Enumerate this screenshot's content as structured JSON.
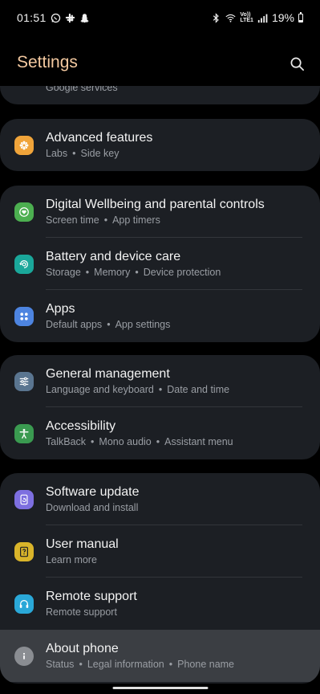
{
  "status_bar": {
    "time": "01:51",
    "left_icons": [
      "whatsapp-icon",
      "slack-icon",
      "snapchat-icon"
    ],
    "right_icons": [
      "bluetooth-icon",
      "wifi-icon",
      "volte-icon",
      "signal-icon"
    ],
    "volte_text_top": "Vo))",
    "volte_text_bottom": "LTE1",
    "battery": "19%"
  },
  "header": {
    "title": "Settings",
    "search_icon": "search-icon"
  },
  "partial_item": {
    "subtitle": "Google services"
  },
  "groups": [
    {
      "items": [
        {
          "icon": "gear-flower-icon",
          "icon_color": "#f0a43a",
          "title": "Advanced features",
          "subtitle": [
            "Labs",
            "Side key"
          ]
        }
      ]
    },
    {
      "items": [
        {
          "icon": "heart-circle-icon",
          "icon_color": "#4caf50",
          "title": "Digital Wellbeing and parental controls",
          "subtitle": [
            "Screen time",
            "App timers"
          ]
        },
        {
          "icon": "refresh-circle-icon",
          "icon_color": "#1aa79a",
          "title": "Battery and device care",
          "subtitle": [
            "Storage",
            "Memory",
            "Device protection"
          ]
        },
        {
          "icon": "apps-grid-icon",
          "icon_color": "#4d84e0",
          "title": "Apps",
          "subtitle": [
            "Default apps",
            "App settings"
          ]
        }
      ]
    },
    {
      "items": [
        {
          "icon": "sliders-icon",
          "icon_color": "#5a7590",
          "title": "General management",
          "subtitle": [
            "Language and keyboard",
            "Date and time"
          ]
        },
        {
          "icon": "accessibility-icon",
          "icon_color": "#3a9a50",
          "title": "Accessibility",
          "subtitle": [
            "TalkBack",
            "Mono audio",
            "Assistant menu"
          ]
        }
      ]
    },
    {
      "items": [
        {
          "icon": "software-update-icon",
          "icon_color": "#7d6fe0",
          "title": "Software update",
          "subtitle": [
            "Download and install"
          ]
        },
        {
          "icon": "user-manual-icon",
          "icon_color": "#d9b42a",
          "title": "User manual",
          "subtitle": [
            "Learn more"
          ]
        },
        {
          "icon": "headset-icon",
          "icon_color": "#2aa8d8",
          "title": "Remote support",
          "subtitle": [
            "Remote support"
          ]
        },
        {
          "icon": "info-icon",
          "icon_color": "#8a8d92",
          "title": "About phone",
          "subtitle": [
            "Status",
            "Legal information",
            "Phone name"
          ]
        }
      ]
    }
  ],
  "colors": {
    "background": "#000000",
    "card": "#1c1f24",
    "title_accent": "#f4c9a0",
    "subtitle": "#9a9ea4",
    "highlight": "#3b3e43"
  }
}
